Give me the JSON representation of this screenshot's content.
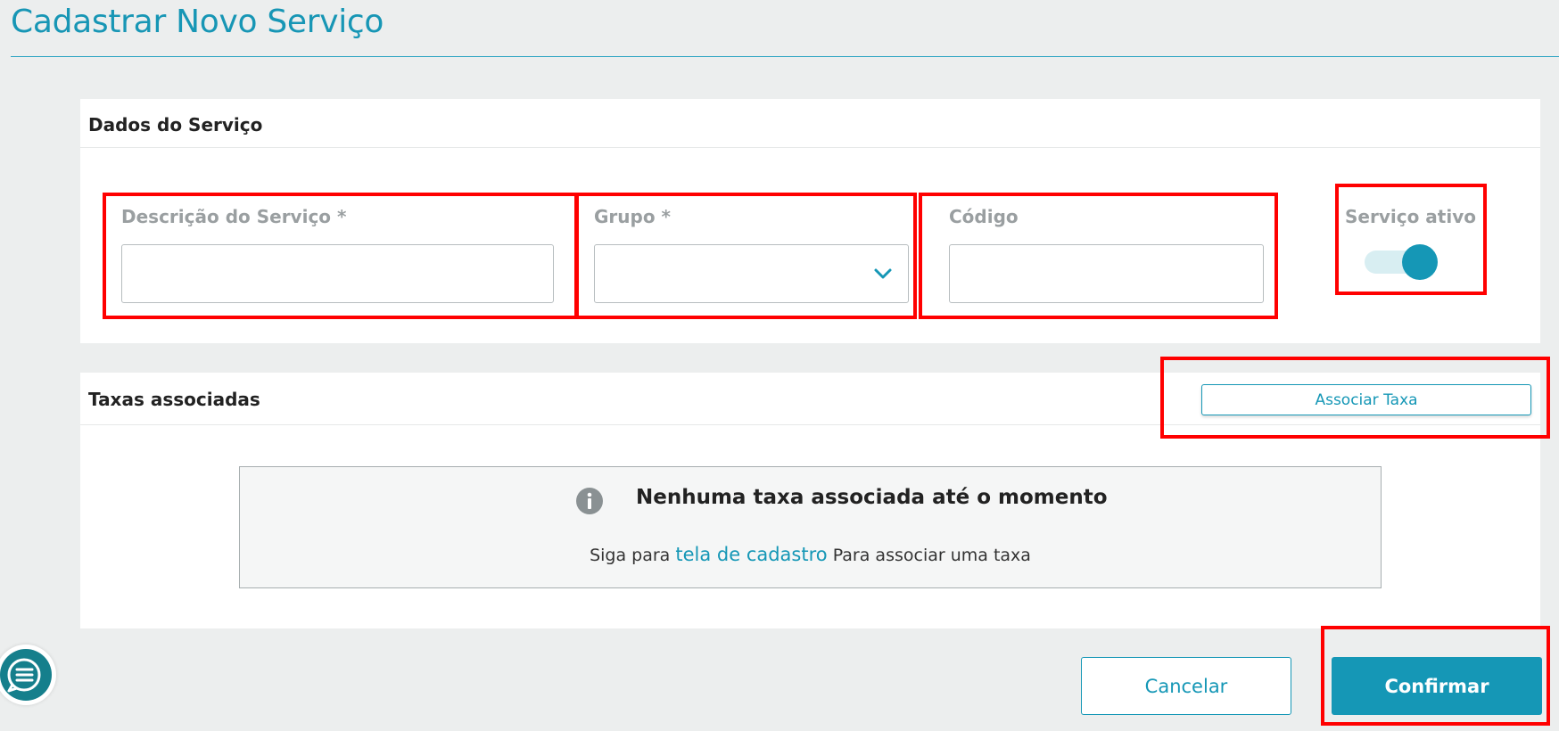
{
  "page": {
    "title": "Cadastrar Novo Serviço"
  },
  "service_section": {
    "title": "Dados do Serviço",
    "fields": {
      "descricao": {
        "label": "Descrição do Serviço *",
        "value": ""
      },
      "grupo": {
        "label": "Grupo *",
        "value": ""
      },
      "codigo": {
        "label": "Código",
        "value": ""
      },
      "ativo": {
        "label": "Serviço ativo",
        "on": true
      }
    }
  },
  "taxes_section": {
    "title": "Taxas associadas",
    "associate_button": "Associar Taxa",
    "empty_state": {
      "title": "Nenhuma taxa associada até o momento",
      "text_before": "Siga para",
      "link": "tela de cadastro",
      "text_after": "Para associar uma taxa"
    }
  },
  "footer": {
    "cancel_label": "Cancelar",
    "confirm_label": "Confirmar"
  },
  "icons": {
    "info": "info-icon",
    "dropdown": "chevron-down-icon",
    "chat": "chat-menu-icon"
  },
  "colors": {
    "accent": "#1597b6",
    "highlight": "#ff0000",
    "background": "#eceeee"
  }
}
